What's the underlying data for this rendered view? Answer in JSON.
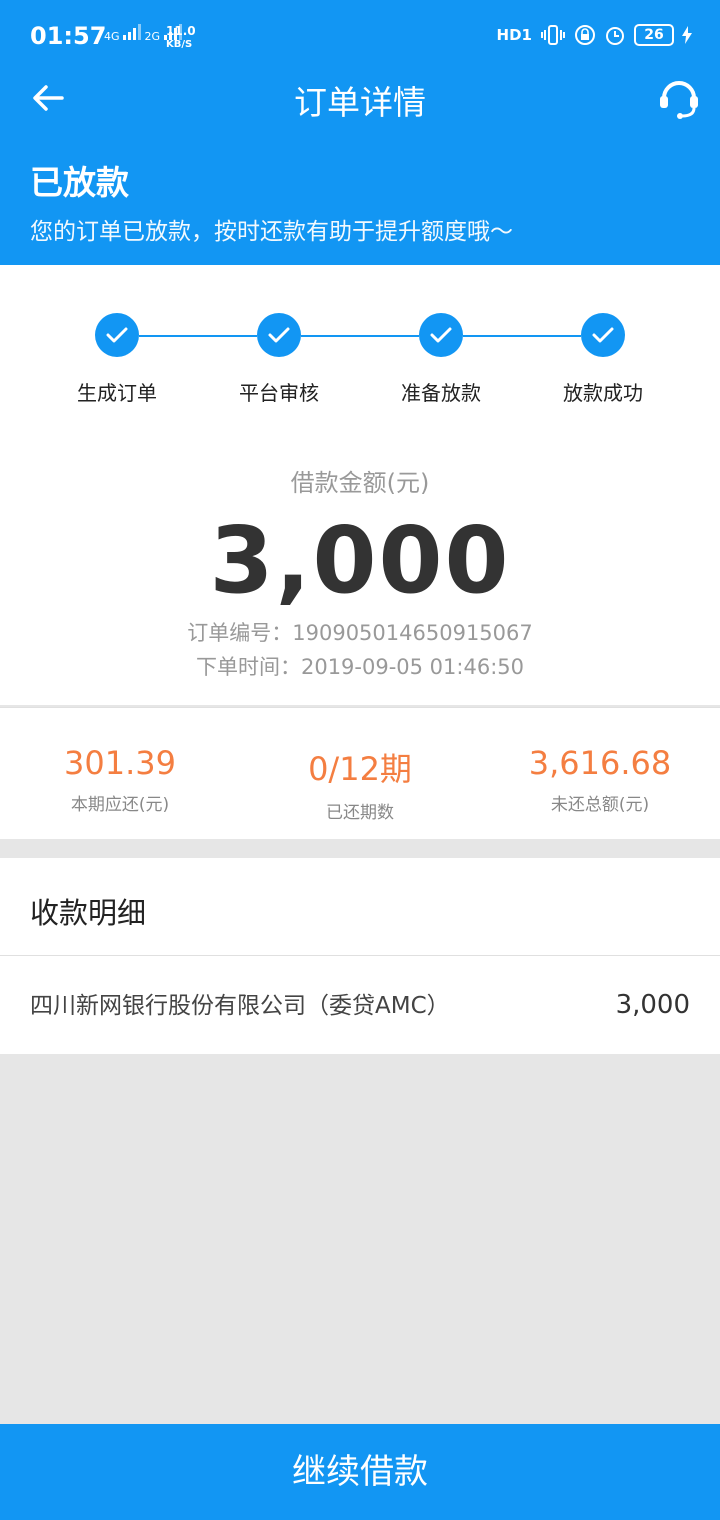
{
  "statusbar": {
    "time": "01:57",
    "net1": "4G",
    "net2": "2G",
    "speed_value": "11.0",
    "speed_unit": "KB/S",
    "hd_label": "HD1",
    "battery": "26"
  },
  "header": {
    "title": "订单详情"
  },
  "order_status": {
    "title": "已放款",
    "subtitle": "您的订单已放款，按时还款有助于提升额度哦～"
  },
  "steps": [
    {
      "label": "生成订单"
    },
    {
      "label": "平台审核"
    },
    {
      "label": "准备放款"
    },
    {
      "label": "放款成功"
    }
  ],
  "loan": {
    "amount_label": "借款金额(元)",
    "amount": "3,000",
    "order_no": "订单编号：190905014650915067",
    "order_time": "下单时间：2019-09-05 01:46:50"
  },
  "stats": [
    {
      "value": "301.39",
      "label": "本期应还(元)"
    },
    {
      "value": "0/12期",
      "label": "已还期数"
    },
    {
      "value": "3,616.68",
      "label": "未还总额(元)"
    }
  ],
  "receipt": {
    "title": "收款明细",
    "rows": [
      {
        "name": "四川新网银行股份有限公司（委贷AMC）",
        "amount": "3,000"
      }
    ]
  },
  "actions": {
    "continue_label": "继续借款"
  },
  "colors": {
    "brand": "#1296f3",
    "accent": "#f47e41"
  }
}
